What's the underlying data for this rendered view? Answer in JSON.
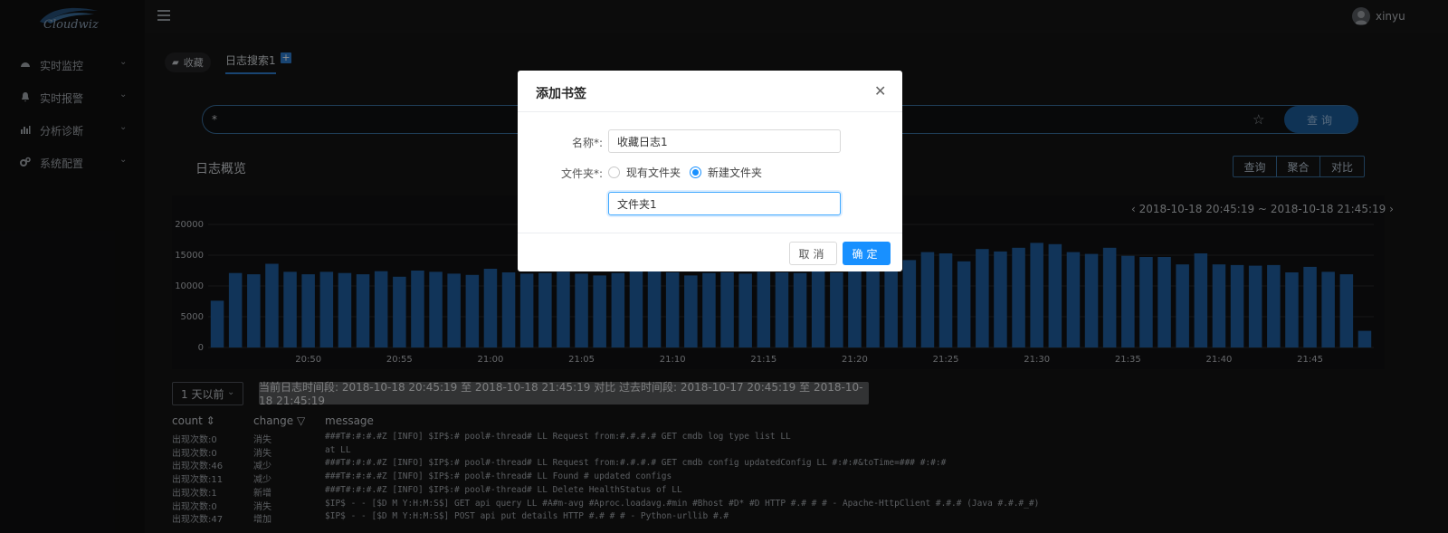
{
  "app": {
    "logo_text": "Cloudwiz",
    "user_name": "xinyu"
  },
  "sidebar": {
    "items": [
      {
        "label": "实时监控",
        "icon": "dashboard-icon"
      },
      {
        "label": "实时报警",
        "icon": "bell-icon"
      },
      {
        "label": "分析诊断",
        "icon": "bar-chart-icon"
      },
      {
        "label": "系统配置",
        "icon": "gears-icon"
      }
    ]
  },
  "tabs": {
    "favorites_label": "收藏",
    "active_tab": "日志搜索1",
    "add_label": "+"
  },
  "search": {
    "value": "*",
    "button_label": "查询"
  },
  "overview": {
    "title": "日志概览",
    "segments": [
      "查询",
      "聚合",
      "对比"
    ],
    "range_start": "2018-10-18 20:45:19",
    "range_sep": "~",
    "range_end": "2018-10-18 21:45:19"
  },
  "chart_data": {
    "type": "bar",
    "y_ticks": [
      "20000",
      "15000",
      "10000",
      "5000",
      "0"
    ],
    "ylim": [
      0,
      20000
    ],
    "x_ticks": [
      "20:50",
      "20:55",
      "21:00",
      "21:05",
      "21:10",
      "21:15",
      "21:20",
      "21:25",
      "21:30",
      "21:35",
      "21:40",
      "21:45"
    ],
    "values": [
      7600,
      12100,
      11900,
      13600,
      12300,
      11900,
      12300,
      12100,
      11900,
      12400,
      11500,
      12500,
      12300,
      12000,
      11800,
      12800,
      12200,
      12000,
      12100,
      12300,
      12000,
      11700,
      12100,
      12400,
      12600,
      12200,
      11700,
      12100,
      12200,
      12000,
      12300,
      12200,
      12100,
      12400,
      12200,
      12600,
      13000,
      14100,
      14200,
      15500,
      15300,
      14000,
      16000,
      15600,
      16200,
      17000,
      16800,
      15500,
      15200,
      16200,
      14900,
      14700,
      14700,
      13500,
      15300,
      13500,
      13400,
      13300,
      13400,
      12200,
      13100,
      12300,
      11900,
      2700
    ],
    "bar_color": "#1f5fa3"
  },
  "compare": {
    "select_value": "1 天以前",
    "info": "当前日志时间段: 2018-10-18 20:45:19 至 2018-10-18 21:45:19 对比 过去时间段: 2018-10-17 20:45:19 至 2018-10-18 21:45:19"
  },
  "logs": {
    "headers": {
      "count": "count ⇕",
      "change": "change ▽",
      "message": "message"
    },
    "rows": [
      {
        "count": "出现次数:0",
        "change": "消失",
        "message": "###T#:#:#.#Z [INFO] $IP$:# pool#-thread# LL Request from:#.#.#.# GET cmdb log type list LL"
      },
      {
        "count": "出现次数:0",
        "change": "消失",
        "message": "at LL"
      },
      {
        "count": "出现次数:46",
        "change": "减少",
        "message": "###T#:#:#.#Z [INFO] $IP$:# pool#-thread# LL Request from:#.#.#.# GET cmdb config updatedConfig LL #:#:#&toTime=### #:#:#"
      },
      {
        "count": "出现次数:11",
        "change": "减少",
        "message": "###T#:#:#.#Z [INFO] $IP$:# pool#-thread# LL Found # updated configs"
      },
      {
        "count": "出现次数:1",
        "change": "新增",
        "message": "###T#:#:#.#Z [INFO] $IP$:# pool#-thread# LL Delete HealthStatus of LL"
      },
      {
        "count": "出现次数:0",
        "change": "消失",
        "message": "$IP$ - - [$D M Y:H:M:S$] GET api query LL #A#m-avg #Aproc.loadavg.#min #Bhost #D* #D HTTP #.# # # - Apache-HttpClient #.#.# (Java #.#.#_#)"
      },
      {
        "count": "出现次数:47",
        "change": "增加",
        "message": "$IP$ - - [$D M Y:H:M:S$] POST api put details HTTP #.# # # - Python-urllib #.#"
      }
    ]
  },
  "modal": {
    "title": "添加书签",
    "name_label": "名称*:",
    "name_value": "收藏日志1",
    "folder_label": "文件夹*:",
    "radio_existing": "现有文件夹",
    "radio_new": "新建文件夹",
    "folder_value": "文件夹1",
    "cancel_label": "取消",
    "ok_label": "确定"
  }
}
